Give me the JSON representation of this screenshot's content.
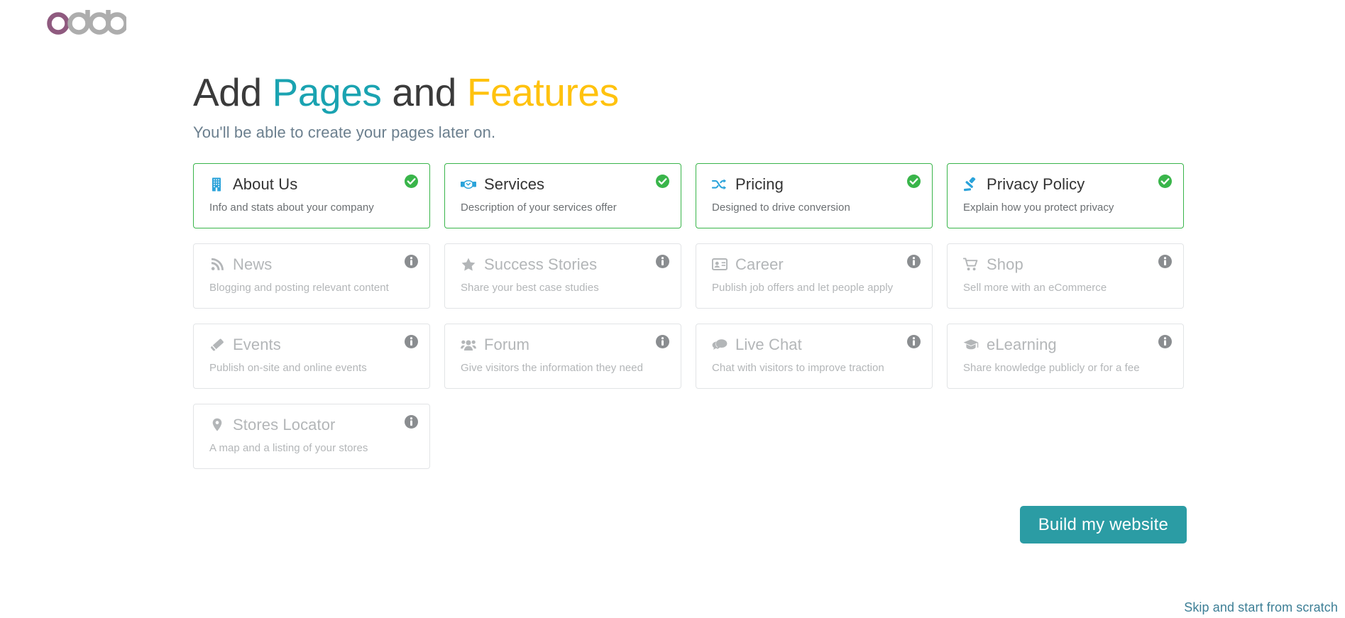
{
  "brand": {
    "name": "odoo",
    "first_letter_color": "#8f5a7f",
    "rest_color": "#adadad"
  },
  "header": {
    "title_part1": "Add ",
    "title_accent1": "Pages",
    "title_part2": " and ",
    "title_accent2": "Features",
    "accent1_color": "#1aa3b1",
    "accent2_color": "#ffc20e",
    "subtitle": "You'll be able to create your pages later on."
  },
  "cards": [
    {
      "id": "about-us",
      "title": "About Us",
      "description": "Info and stats about your company",
      "icon": "building-icon",
      "selected": true,
      "badge": "check-circle-icon"
    },
    {
      "id": "services",
      "title": "Services",
      "description": "Description of your services offer",
      "icon": "handshake-icon",
      "selected": true,
      "badge": "check-circle-icon"
    },
    {
      "id": "pricing",
      "title": "Pricing",
      "description": "Designed to drive conversion",
      "icon": "shuffle-icon",
      "selected": true,
      "badge": "check-circle-icon"
    },
    {
      "id": "privacy-policy",
      "title": "Privacy Policy",
      "description": "Explain how you protect privacy",
      "icon": "gavel-icon",
      "selected": true,
      "badge": "check-circle-icon"
    },
    {
      "id": "news",
      "title": "News",
      "description": "Blogging and posting relevant content",
      "icon": "rss-icon",
      "selected": false,
      "badge": "info-circle-icon"
    },
    {
      "id": "success-stories",
      "title": "Success Stories",
      "description": "Share your best case studies",
      "icon": "star-icon",
      "selected": false,
      "badge": "info-circle-icon"
    },
    {
      "id": "career",
      "title": "Career",
      "description": "Publish job offers and let people apply",
      "icon": "id-card-icon",
      "selected": false,
      "badge": "info-circle-icon"
    },
    {
      "id": "shop",
      "title": "Shop",
      "description": "Sell more with an eCommerce",
      "icon": "shopping-cart-icon",
      "selected": false,
      "badge": "info-circle-icon"
    },
    {
      "id": "events",
      "title": "Events",
      "description": "Publish on-site and online events",
      "icon": "ticket-icon",
      "selected": false,
      "badge": "info-circle-icon"
    },
    {
      "id": "forum",
      "title": "Forum",
      "description": "Give visitors the information they need",
      "icon": "users-icon",
      "selected": false,
      "badge": "info-circle-icon"
    },
    {
      "id": "live-chat",
      "title": "Live Chat",
      "description": "Chat with visitors to improve traction",
      "icon": "comments-icon",
      "selected": false,
      "badge": "info-circle-icon"
    },
    {
      "id": "elearning",
      "title": "eLearning",
      "description": "Share knowledge publicly or for a fee",
      "icon": "graduation-cap-icon",
      "selected": false,
      "badge": "info-circle-icon"
    },
    {
      "id": "stores-locator",
      "title": "Stores Locator",
      "description": "A map and a listing of your stores",
      "icon": "map-pin-icon",
      "selected": false,
      "badge": "info-circle-icon"
    }
  ],
  "actions": {
    "build_label": "Build my website",
    "build_color": "#2b9ca4",
    "skip_label": "Skip and start from scratch",
    "skip_color": "#3d7f96"
  }
}
